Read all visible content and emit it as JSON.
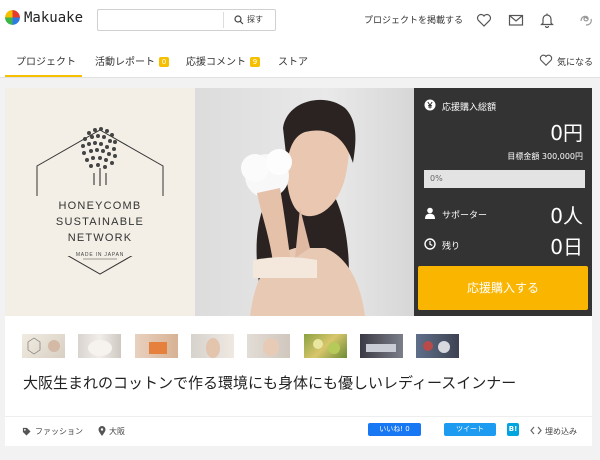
{
  "header": {
    "logo_text": "Makuake",
    "search_placeholder": "",
    "search_button": "探す",
    "post_project": "プロジェクトを掲載する"
  },
  "nav": {
    "tabs": [
      {
        "label": "プロジェクト"
      },
      {
        "label": "活動レポート",
        "badge": "0"
      },
      {
        "label": "応援コメント",
        "badge": "9"
      },
      {
        "label": "ストア"
      }
    ],
    "favorite": "気になる"
  },
  "hero": {
    "brand_lines": [
      "HONEYCOMB",
      "SUSTAINABLE",
      "NETWORK"
    ],
    "made_in": "MADE IN JAPAN"
  },
  "funding": {
    "total_label": "応援購入総額",
    "total_value": "0円",
    "goal_label": "目標金額 300,000円",
    "progress_text": "0%",
    "progress": 0,
    "supporters_label": "サポーター",
    "supporters_value": "0人",
    "remaining_label": "残り",
    "remaining_value": "0日",
    "cta": "応援購入する"
  },
  "project_title": "大阪生まれのコットンで作る環境にも身体にも優しいレディースインナー",
  "footer": {
    "category": "ファッション",
    "location": "大阪",
    "like": "いいね! 0",
    "tweet": "ツイート",
    "hatena": "B!",
    "embed": "埋め込み"
  },
  "colors": {
    "accent": "#f9b500",
    "panel": "#333333",
    "facebook": "#1877f2",
    "twitter": "#1d9bf0",
    "hatena": "#00a4de"
  }
}
